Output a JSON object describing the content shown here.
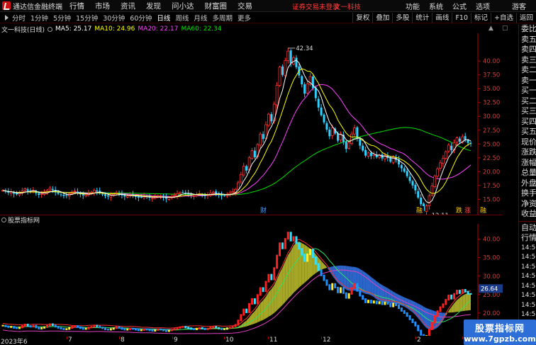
{
  "menubar": {
    "app_title": "通达信金融终端",
    "items": [
      "行情",
      "市场",
      "资讯",
      "发现",
      "问小达",
      "财富圈",
      "交易"
    ],
    "login_status": "证券交易未登录",
    "stock_title": "文一科技",
    "right_items": [
      "功能",
      "系统",
      "公式",
      "选项"
    ],
    "guest": "游客"
  },
  "toolbar": {
    "periods": [
      "分时",
      "1分钟",
      "5分钟",
      "15分钟",
      "30分钟",
      "60分钟",
      "日线",
      "周线",
      "月线",
      "多周期",
      "更多"
    ],
    "active_period": "日线",
    "right_tools": [
      "复权",
      "叠加",
      "多股",
      "统计",
      "画线",
      "F10",
      "标记",
      "+自选",
      "返回"
    ]
  },
  "ma_line": {
    "stock": "文一科技(日线)",
    "ma5": "MA5: 25.17",
    "ma10": "MA10: 24.96",
    "ma20": "MA20: 22.17",
    "ma60": "MA60: 22.34"
  },
  "colors": {
    "ma5": "#ffffff",
    "ma10": "#ffff00",
    "ma20": "#ff40ff",
    "ma60": "#00e000",
    "up": "#ff3030",
    "down": "#30d0ff",
    "axis": "#b00000",
    "accent_red": "#ff3a3a",
    "watermark_bg": "#2d6fd6"
  },
  "sub_panel": {
    "label": "股票指标网",
    "current_value": "26.64"
  },
  "chart_data": [
    {
      "type": "candlestick",
      "title": "文一科技(日线)",
      "y_ticks": [
        "40.00",
        "37.50",
        "35.00",
        "32.50",
        "30.00",
        "27.50",
        "25.00",
        "22.50",
        "20.00",
        "17.50",
        "15.00"
      ],
      "ylim": [
        13.5,
        44
      ],
      "high_annotation": "42.34",
      "low_annotation": "12.11",
      "event_markers": [
        "财",
        "融",
        "跌",
        "涨",
        "融"
      ],
      "series": [
        {
          "name": "MA5",
          "value": 25.17
        },
        {
          "name": "MA10",
          "value": 24.96
        },
        {
          "name": "MA20",
          "value": 22.17
        },
        {
          "name": "MA60",
          "value": 22.34
        }
      ],
      "close": [
        16.6,
        16.4,
        16.2,
        16.3,
        16.0,
        15.9,
        16.1,
        16.5,
        16.9,
        16.5,
        16.3,
        16.6,
        16.1,
        15.8,
        16.0,
        16.2,
        16.6,
        17.0,
        16.7,
        16.3,
        16.0,
        15.8,
        15.6,
        15.7,
        16.0,
        16.3,
        16.5,
        16.2,
        15.9,
        15.7,
        15.8,
        16.1,
        16.3,
        16.6,
        16.4,
        16.1,
        15.9,
        15.6,
        15.5,
        15.7,
        15.9,
        16.2,
        16.0,
        15.7,
        15.5,
        15.6,
        15.8,
        15.7,
        15.5,
        15.3,
        15.4,
        15.6,
        15.5,
        15.3,
        15.2,
        15.4,
        15.6,
        15.5,
        15.3,
        15.1,
        15.3,
        15.5,
        15.7,
        16.0,
        16.2,
        16.3,
        16.1,
        15.9,
        15.7,
        15.6,
        15.8,
        16.0,
        15.8,
        15.6,
        15.8,
        16.1,
        16.3,
        16.0,
        15.8,
        15.6,
        15.7,
        15.9,
        16.1,
        16.4,
        16.8,
        18.0,
        19.5,
        21.0,
        20.2,
        22.5,
        23.8,
        22.6,
        24.9,
        26.8,
        25.9,
        28.5,
        30.4,
        29.1,
        32.2,
        35.6,
        38.9,
        37.5,
        40.1,
        41.8,
        39.6,
        40.6,
        38.9,
        37.4,
        35.8,
        34.1,
        35.9,
        37.2,
        35.1,
        33.3,
        31.6,
        30.2,
        28.9,
        27.6,
        26.4,
        27.9,
        26.9,
        25.6,
        26.8,
        25.4,
        24.1,
        25.2,
        26.8,
        27.9,
        26.0,
        24.7,
        23.8,
        22.9,
        23.4,
        22.8,
        23.2,
        22.6,
        23.0,
        22.4,
        22.9,
        22.5,
        21.8,
        22.6,
        22.1,
        21.3,
        20.6,
        20.0,
        19.2,
        18.3,
        17.5,
        16.6,
        15.3,
        14.1,
        12.9,
        13.8,
        15.6,
        17.4,
        19.2,
        20.5,
        21.6,
        22.4,
        23.6,
        24.8,
        23.9,
        25.2,
        26.1,
        25.4,
        26.3,
        25.8,
        25.2,
        25.17
      ]
    },
    {
      "type": "area",
      "title": "股票指标网",
      "y_ticks": [
        "40.00",
        "35.00",
        "30.00",
        "25.00",
        "20.00"
      ],
      "ylim": [
        15,
        43
      ]
    }
  ],
  "date_axis": [
    "2023年6",
    "7",
    "8",
    "9",
    "10",
    "11",
    "12",
    "2",
    "3"
  ],
  "right_column": {
    "quote_labels": [
      "委比",
      "卖五",
      "卖四",
      "卖三",
      "卖二",
      "卖一",
      "买一",
      "买二",
      "买三",
      "买四",
      "买五",
      "现价",
      "涨跌",
      "涨幅",
      "总量",
      "外盘",
      "换手",
      "净资",
      "收益"
    ],
    "tabs": [
      "自动",
      "行情"
    ],
    "times": [
      "14:50",
      "14:50",
      "14:50",
      "14:50",
      "14:50",
      "14:50",
      "14:50",
      "14:50",
      "14:50",
      "14:50"
    ]
  },
  "watermark": {
    "title": "股票指标网",
    "url": "www.7gpzb.com"
  }
}
